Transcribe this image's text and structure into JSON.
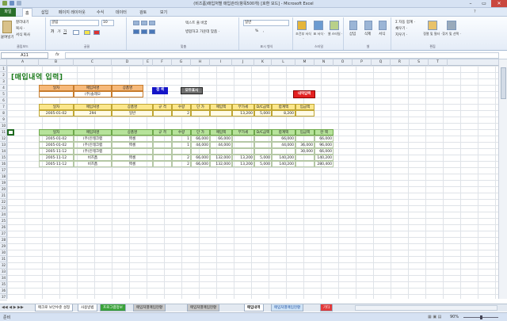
{
  "window": {
    "title": "(비즈폼)매입처별 매입관리(항목500개) [호환 모드] - Microsoft Excel",
    "min": "–",
    "max": "▭",
    "close": "✕"
  },
  "menu": {
    "file": "파일",
    "tabs": [
      "홈",
      "삽입",
      "페이지 레이아웃",
      "수식",
      "데이터",
      "검토",
      "보기"
    ]
  },
  "ribbon": {
    "clipboard": {
      "name": "클립보드",
      "paste": "붙여넣기",
      "cut": "잘라내기",
      "copy": "복사 ·",
      "format_painter": "서식 복사"
    },
    "font": {
      "name": "글꼴",
      "font_name": "굴림",
      "font_size": "10",
      "bold": "가",
      "italic": "가",
      "underline": "가"
    },
    "alignment": {
      "name": "맞춤",
      "wrap": "텍스트 줄 바꿈",
      "merge": "병합하고 가운데 맞춤 ·"
    },
    "number": {
      "name": "표시 형식",
      "format": "일반",
      "percent": "%",
      "comma": ","
    },
    "styles": {
      "name": "스타일",
      "cond": "조건부 서식 ·",
      "table": "표 서식 ·",
      "cell": "셀 스타일 ·"
    },
    "cells": {
      "name": "셀",
      "insert": "삽입",
      "delete": "삭제",
      "format": "서식"
    },
    "editing": {
      "name": "편집",
      "autosum": "Σ 자동 합계 ·",
      "fill": "채우기 ·",
      "clear": "지우기 ·",
      "sort": "정렬 및 필터 ·",
      "find": "찾기 및 선택 ·"
    }
  },
  "formula_bar": {
    "name_box": "A11",
    "fx": "fx",
    "content": ""
  },
  "columns": [
    "A",
    "B",
    "C",
    "D",
    "E",
    "F",
    "G",
    "H",
    "I",
    "J",
    "K",
    "L",
    "M",
    "N",
    "O",
    "P",
    "Q",
    "R",
    "S",
    "T"
  ],
  "rows": [
    "1",
    "2",
    "3",
    "4",
    "5",
    "6",
    "7",
    "8",
    "9",
    "10",
    "11",
    "12",
    "13",
    "14",
    "15",
    "16",
    "17",
    "18",
    "19",
    "20",
    "21",
    "22",
    "23",
    "24",
    "25",
    "26",
    "27",
    "28",
    "29",
    "30",
    "31",
    "32",
    "33",
    "34",
    "35",
    "36",
    "37"
  ],
  "sheet": {
    "heading": "[매입내역 입력]",
    "search_header": [
      "일자",
      "매입처명",
      "상품명"
    ],
    "search_values": [
      "",
      "(주)솔레오",
      ""
    ],
    "btn_search": "검 색",
    "btn_show_all": "모두표시",
    "btn_input": "내역입력",
    "input_header": [
      "일자",
      "매입처명",
      "상품명",
      "규 격",
      "수량",
      "단 가",
      "매입액",
      "부가세",
      "D/C금액",
      "합계액",
      "입금액"
    ],
    "input_values": [
      "2005-01-02",
      "294",
      "일반",
      "",
      "2",
      "",
      "",
      "13,200",
      "5,000",
      "8,200",
      ""
    ],
    "list_header": [
      "일자",
      "매입처명",
      "상품명",
      "규 격",
      "수량",
      "단 가",
      "매입액",
      "부가세",
      "D/C금액",
      "합계액",
      "입금액",
      "잔 액"
    ],
    "list_rows": [
      [
        "2005-01-02",
        "(주)인테크랩",
        "엑셀",
        "",
        "1",
        "66,000",
        "66,000",
        "",
        "",
        "66,000",
        "",
        "66,000"
      ],
      [
        "2005-01-02",
        "(주)인테크랩",
        "엑셀",
        "",
        "1",
        "44,000",
        "44,000",
        "",
        "",
        "44,000",
        "36,000",
        "96,000"
      ],
      [
        "2005-11-12",
        "(주)인테크랩",
        "",
        "",
        "",
        "",
        "",
        "",
        "",
        "",
        "30,000",
        "66,000"
      ],
      [
        "2005-11-12",
        "비즈폼",
        "엑셀",
        "",
        "2",
        "66,000",
        "132,000",
        "13,200",
        "5,000",
        "140,200",
        "",
        "140,200"
      ],
      [
        "2005-11-12",
        "비즈폼",
        "엑셀",
        "",
        "2",
        "66,000",
        "132,000",
        "13,200",
        "5,000",
        "140,200",
        "",
        "280,400"
      ]
    ]
  },
  "sheet_tabs": [
    "매크로 보안수준 설정",
    "사용방법",
    "프로그램정보",
    "매입처별매입현황",
    "매입처별매입현황",
    "매입내역",
    "매입처별매입현황",
    "기타"
  ],
  "status": {
    "ready": "준비",
    "zoom": "90%"
  }
}
